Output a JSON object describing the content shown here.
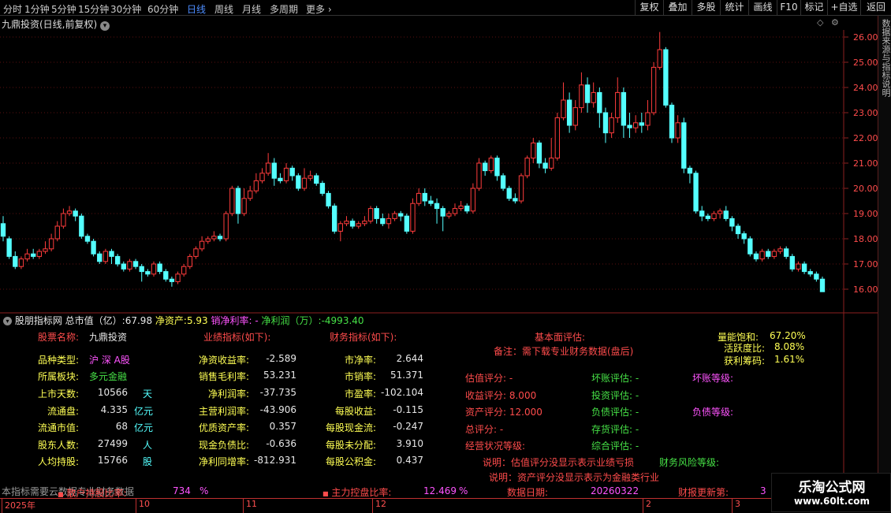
{
  "topbar": {
    "periods": [
      "分时",
      "1分钟",
      "5分钟",
      "15分钟",
      "30分钟",
      "60分钟",
      "日线",
      "周线",
      "月线",
      "多周期",
      "更多"
    ],
    "active_period": "日线",
    "more_chevron": "chevron-right-icon",
    "buttons": [
      "复权",
      "叠加",
      "多股",
      "统计",
      "画线",
      "F10",
      "标记",
      "+自选",
      "返回"
    ]
  },
  "chart": {
    "title": "九鼎投资(日线,前复权)",
    "y_ticks": [
      "26.00",
      "25.00",
      "24.00",
      "23.00",
      "22.00",
      "21.00",
      "20.00",
      "19.00",
      "18.00",
      "17.00",
      "16.00"
    ],
    "up_color": "#ff3c3c",
    "down_color": "#54ffff",
    "grid_color": "#5a0f0f"
  },
  "chart_data": {
    "type": "candlestick",
    "ylim": [
      15.5,
      26.5
    ],
    "ohlc": [
      [
        18.6,
        18.1,
        18.9,
        17.9
      ],
      [
        18.0,
        17.3,
        18.1,
        17.2
      ],
      [
        17.3,
        16.9,
        17.5,
        16.8
      ],
      [
        16.9,
        17.2,
        17.3,
        16.8
      ],
      [
        17.2,
        17.4,
        17.6,
        17.1
      ],
      [
        17.4,
        17.3,
        17.6,
        17.2
      ],
      [
        17.3,
        17.5,
        17.6,
        17.2
      ],
      [
        17.5,
        17.6,
        17.9,
        17.4
      ],
      [
        17.6,
        18.0,
        18.2,
        17.5
      ],
      [
        18.0,
        18.5,
        18.7,
        17.9
      ],
      [
        18.5,
        19.0,
        19.2,
        18.4
      ],
      [
        19.0,
        19.1,
        19.3,
        18.9
      ],
      [
        19.1,
        18.9,
        19.2,
        18.7
      ],
      [
        18.9,
        18.1,
        19.0,
        18.0
      ],
      [
        18.1,
        17.9,
        18.2,
        17.8
      ],
      [
        17.9,
        17.4,
        18.0,
        17.3
      ],
      [
        17.4,
        17.1,
        17.5,
        17.0
      ],
      [
        17.1,
        17.5,
        17.6,
        17.0
      ],
      [
        17.5,
        17.3,
        17.6,
        17.0
      ],
      [
        17.3,
        17.0,
        17.4,
        16.9
      ],
      [
        17.0,
        16.8,
        17.1,
        16.7
      ],
      [
        16.8,
        17.1,
        17.2,
        16.7
      ],
      [
        17.1,
        16.9,
        17.2,
        16.8
      ],
      [
        16.9,
        16.7,
        17.0,
        16.3
      ],
      [
        16.7,
        16.6,
        16.8,
        16.5
      ],
      [
        16.6,
        17.0,
        17.1,
        16.5
      ],
      [
        17.0,
        16.7,
        17.1,
        16.6
      ],
      [
        16.7,
        16.4,
        16.8,
        16.3
      ],
      [
        16.4,
        16.3,
        16.5,
        16.1
      ],
      [
        16.3,
        16.6,
        16.7,
        16.2
      ],
      [
        16.6,
        16.9,
        17.0,
        16.5
      ],
      [
        16.9,
        17.3,
        17.4,
        16.8
      ],
      [
        17.3,
        17.6,
        17.7,
        17.2
      ],
      [
        17.6,
        17.9,
        18.1,
        17.5
      ],
      [
        17.9,
        18.0,
        18.1,
        17.8
      ],
      [
        18.0,
        18.1,
        18.3,
        17.9
      ],
      [
        18.1,
        18.0,
        18.2,
        17.9
      ],
      [
        18.0,
        19.0,
        19.1,
        17.9
      ],
      [
        19.0,
        20.0,
        20.1,
        18.9
      ],
      [
        20.0,
        19.0,
        20.1,
        18.6
      ],
      [
        19.0,
        19.6,
        20.0,
        18.9
      ],
      [
        19.6,
        19.9,
        20.1,
        19.5
      ],
      [
        19.9,
        20.3,
        20.6,
        19.8
      ],
      [
        20.3,
        20.6,
        20.8,
        20.2
      ],
      [
        20.6,
        21.0,
        21.4,
        20.5
      ],
      [
        21.0,
        20.4,
        21.2,
        20.1
      ],
      [
        20.4,
        20.3,
        20.6,
        20.2
      ],
      [
        20.3,
        20.8,
        21.0,
        20.2
      ],
      [
        20.8,
        20.5,
        20.9,
        20.3
      ],
      [
        20.5,
        20.0,
        20.6,
        19.9
      ],
      [
        20.0,
        20.4,
        20.8,
        19.9
      ],
      [
        20.4,
        20.5,
        20.7,
        20.3
      ],
      [
        20.5,
        20.2,
        20.6,
        20.1
      ],
      [
        20.2,
        19.8,
        20.3,
        19.7
      ],
      [
        19.8,
        19.3,
        19.9,
        19.2
      ],
      [
        19.3,
        18.3,
        19.4,
        18.2
      ],
      [
        18.3,
        18.6,
        18.7,
        17.9
      ],
      [
        18.6,
        18.7,
        18.9,
        18.5
      ],
      [
        18.7,
        18.5,
        18.8,
        18.4
      ],
      [
        18.5,
        18.6,
        18.7,
        18.4
      ],
      [
        18.6,
        18.7,
        18.9,
        18.5
      ],
      [
        18.7,
        19.2,
        19.3,
        18.6
      ],
      [
        19.2,
        18.8,
        19.3,
        18.6
      ],
      [
        18.8,
        18.6,
        19.0,
        18.5
      ],
      [
        18.6,
        18.8,
        19.0,
        18.4
      ],
      [
        18.8,
        19.0,
        19.1,
        18.7
      ],
      [
        19.0,
        18.9,
        19.1,
        18.7
      ],
      [
        18.9,
        18.3,
        19.0,
        18.2
      ],
      [
        18.3,
        19.4,
        19.6,
        18.2
      ],
      [
        19.4,
        19.8,
        20.0,
        19.3
      ],
      [
        19.8,
        19.5,
        20.0,
        19.3
      ],
      [
        19.5,
        19.4,
        19.7,
        19.3
      ],
      [
        19.4,
        19.2,
        19.6,
        18.6
      ],
      [
        19.2,
        18.9,
        19.3,
        18.3
      ],
      [
        18.9,
        19.0,
        19.1,
        18.8
      ],
      [
        19.0,
        19.2,
        19.4,
        18.9
      ],
      [
        19.2,
        19.3,
        19.5,
        19.1
      ],
      [
        19.3,
        19.1,
        19.4,
        19.0
      ],
      [
        19.1,
        20.0,
        20.2,
        19.0
      ],
      [
        20.0,
        21.0,
        21.2,
        19.9
      ],
      [
        21.0,
        20.7,
        21.1,
        20.5
      ],
      [
        20.7,
        21.2,
        21.3,
        20.6
      ],
      [
        21.2,
        20.5,
        21.3,
        20.3
      ],
      [
        20.5,
        20.0,
        20.6,
        19.9
      ],
      [
        20.0,
        19.6,
        20.1,
        19.5
      ],
      [
        19.6,
        19.5,
        19.8,
        19.4
      ],
      [
        19.5,
        20.5,
        20.6,
        19.4
      ],
      [
        20.5,
        21.2,
        21.3,
        20.4
      ],
      [
        21.2,
        21.8,
        22.0,
        21.0
      ],
      [
        21.8,
        21.0,
        21.9,
        20.8
      ],
      [
        21.0,
        20.8,
        21.2,
        20.6
      ],
      [
        20.8,
        21.2,
        22.0,
        20.7
      ],
      [
        21.2,
        22.8,
        23.0,
        21.1
      ],
      [
        22.8,
        23.5,
        24.2,
        22.7
      ],
      [
        23.5,
        22.5,
        23.8,
        22.2
      ],
      [
        22.5,
        23.2,
        23.5,
        22.3
      ],
      [
        23.2,
        24.1,
        24.6,
        23.0
      ],
      [
        24.1,
        23.4,
        24.4,
        23.0
      ],
      [
        23.4,
        23.8,
        24.2,
        23.2
      ],
      [
        23.8,
        23.0,
        24.0,
        22.4
      ],
      [
        23.0,
        22.2,
        23.2,
        21.8
      ],
      [
        22.2,
        22.8,
        23.0,
        22.0
      ],
      [
        22.8,
        23.8,
        24.4,
        22.6
      ],
      [
        23.8,
        22.5,
        24.0,
        22.0
      ],
      [
        22.5,
        22.4,
        23.0,
        22.0
      ],
      [
        22.4,
        22.6,
        22.9,
        22.2
      ],
      [
        22.6,
        22.5,
        23.0,
        22.2
      ],
      [
        22.5,
        23.0,
        23.5,
        22.3
      ],
      [
        23.0,
        24.8,
        25.0,
        22.9
      ],
      [
        24.8,
        25.5,
        26.2,
        24.7
      ],
      [
        25.5,
        23.3,
        25.6,
        23.2
      ],
      [
        23.3,
        22.0,
        23.4,
        21.8
      ],
      [
        22.0,
        22.6,
        22.9,
        21.8
      ],
      [
        22.6,
        20.8,
        22.8,
        20.6
      ],
      [
        20.8,
        20.6,
        20.9,
        20.2
      ],
      [
        20.6,
        19.1,
        20.7,
        19.0
      ],
      [
        19.1,
        18.9,
        19.3,
        18.7
      ],
      [
        18.9,
        18.8,
        19.0,
        18.7
      ],
      [
        18.8,
        19.0,
        19.1,
        18.7
      ],
      [
        19.0,
        19.1,
        19.2,
        18.8
      ],
      [
        19.1,
        18.8,
        19.3,
        18.7
      ],
      [
        18.8,
        18.5,
        18.9,
        18.3
      ],
      [
        18.5,
        18.2,
        18.6,
        18.0
      ],
      [
        18.2,
        18.0,
        18.3,
        17.8
      ],
      [
        18.0,
        17.4,
        18.1,
        17.3
      ],
      [
        17.4,
        17.2,
        17.5,
        17.1
      ],
      [
        17.2,
        17.5,
        17.6,
        17.1
      ],
      [
        17.5,
        17.3,
        17.6,
        17.2
      ],
      [
        17.3,
        17.5,
        17.6,
        17.2
      ],
      [
        17.5,
        17.6,
        17.7,
        17.4
      ],
      [
        17.6,
        17.3,
        17.7,
        17.2
      ],
      [
        17.3,
        16.8,
        17.4,
        16.7
      ],
      [
        16.8,
        17.0,
        17.1,
        16.7
      ],
      [
        17.0,
        16.7,
        17.1,
        16.6
      ],
      [
        16.7,
        16.6,
        16.8,
        16.5
      ],
      [
        16.6,
        16.4,
        16.7,
        16.3
      ],
      [
        16.4,
        15.9,
        16.5,
        15.9
      ]
    ]
  },
  "panel": {
    "header": {
      "name": "股朋指标网",
      "mv_label": "总市值（亿）:",
      "mv_value": "67.98",
      "na_label": "净资产:",
      "na_value": "5.93",
      "np_label": "销净利率: -",
      "net_label": "净利润（万）:",
      "net_value": "-4993.40"
    },
    "col1": {
      "stock_name_label": "股票名称:",
      "stock_name": "九鼎投资",
      "rows": [
        {
          "label": "品种类型:",
          "value": "沪 深 A股",
          "unit": ""
        },
        {
          "label": "所属板块:",
          "value": "多元金融",
          "unit": ""
        },
        {
          "label": "上市天数:",
          "value": "10566",
          "unit": "天"
        },
        {
          "label": "流通盘:",
          "value": "4.335",
          "unit": "亿元"
        },
        {
          "label": "流通市值:",
          "value": "68",
          "unit": "亿元"
        },
        {
          "label": "股东人数:",
          "value": "27499",
          "unit": "人"
        },
        {
          "label": "人均持股:",
          "value": "15766",
          "unit": "股"
        }
      ]
    },
    "col2": {
      "title": "业绩指标(如下):",
      "rows": [
        {
          "label": "净资收益率:",
          "value": "-2.589"
        },
        {
          "label": "销售毛利率:",
          "value": "53.231"
        },
        {
          "label": "净利润率:",
          "value": "-37.735"
        },
        {
          "label": "主营利润率:",
          "value": "-43.906"
        },
        {
          "label": "优质资产率:",
          "value": "0.357"
        },
        {
          "label": "现金负债比:",
          "value": "-0.636"
        },
        {
          "label": "净利同增率:",
          "value": "-812.931"
        }
      ]
    },
    "col3": {
      "title": "财务指标(如下):",
      "rows": [
        {
          "label": "市净率:",
          "value": "2.644"
        },
        {
          "label": "市销率:",
          "value": "51.371"
        },
        {
          "label": "市盈率:",
          "value": "-102.104"
        },
        {
          "label": "每股收益:",
          "value": "-0.115"
        },
        {
          "label": "每股现金流:",
          "value": "-0.247"
        },
        {
          "label": "每股未分配:",
          "value": "3.910"
        },
        {
          "label": "每股公积金:",
          "value": "0.437"
        }
      ]
    },
    "eval": {
      "title": "基本面评估:",
      "note": "备注：需下载专业财务数据(盘后)",
      "left": [
        "估值评分: -",
        "收益评分: 8.000",
        "资产评分: 12.000",
        "总评分: -",
        "经营状况等级:"
      ],
      "mid": [
        "坏账评估: -",
        "投资评估: -",
        "负债评估: -",
        "存货评估: -",
        "综合评估: -"
      ],
      "right": [
        "坏账等级:",
        "负债等级:"
      ],
      "expl1": "说明：估值评分没显示表示业绩亏损",
      "expl2": "说明：资产评分没显示表示为金融类行业",
      "risk": "财务风险等级:"
    },
    "top_right": [
      {
        "label": "量能饱和:",
        "value": "67.20%"
      },
      {
        "label": "活跃度比:",
        "value": "8.08%"
      },
      {
        "label": "获利筹码:",
        "value": "1.61%"
      }
    ],
    "bottom": {
      "note": "本指标需要云数据专业财务数据",
      "overlap": "散户持股比率:",
      "v1": "734",
      "p1": "%",
      "ctrl_label": "主力控盘比率:",
      "ctrl_value": "12.469",
      "ctrl_unit": "%",
      "date_label": "数据日期:",
      "date_value": "20260322",
      "update_label": "财报更新第:",
      "update_value": "3"
    }
  },
  "bottom_axis": [
    "2025年",
    "10",
    "11",
    "12",
    "2",
    "3"
  ],
  "right_edge": "数据来源与指标说明",
  "watermark": {
    "line1": "乐淘公式网",
    "line2": "www.60lt.com"
  }
}
